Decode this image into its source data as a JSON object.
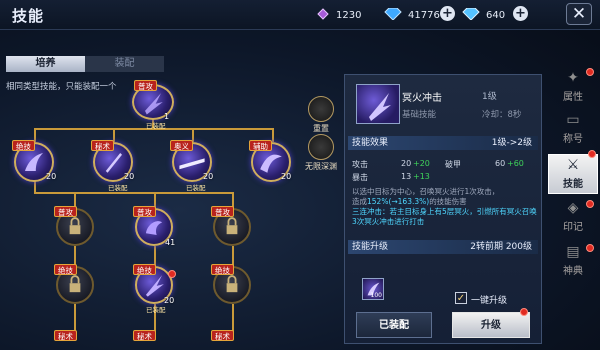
{
  "header": {
    "title": "技能"
  },
  "currencies": [
    {
      "icon": "purple-gem-icon",
      "value": "1230"
    },
    {
      "icon": "blue-diamond-icon",
      "value": "41776"
    },
    {
      "icon": "blue-diamond-icon",
      "value": "640"
    }
  ],
  "left_tabs": [
    {
      "label": "培养"
    },
    {
      "label": "装配"
    }
  ],
  "hint": "相同类型技能，只能装配一个",
  "skill_tree": {
    "root": {
      "tag": "普攻",
      "count": "1",
      "equipped": "已装配"
    },
    "row1": [
      {
        "tag": "绝技",
        "count": "20",
        "equipped": ""
      },
      {
        "tag": "秘术",
        "count": "20",
        "equipped": "已装配"
      },
      {
        "tag": "奥义",
        "count": "20",
        "equipped": "已装配"
      },
      {
        "tag": "辅助",
        "count": "20",
        "equipped": ""
      }
    ],
    "row2": [
      {
        "tag": "普攻",
        "count": "",
        "equipped": ""
      },
      {
        "tag": "普攻",
        "count": "41",
        "equipped": ""
      },
      {
        "tag": "普攻",
        "count": "",
        "equipped": ""
      }
    ],
    "row3": [
      {
        "tag": "绝技",
        "count": "",
        "equipped": ""
      },
      {
        "tag": "绝技",
        "count": "20",
        "equipped": "已装配"
      },
      {
        "tag": "绝技",
        "count": "",
        "equipped": ""
      }
    ],
    "row4": [
      {
        "tag": "秘术"
      },
      {
        "tag": "秘术"
      },
      {
        "tag": "秘术"
      }
    ]
  },
  "side_actions": [
    {
      "label": "重置"
    },
    {
      "label": "无限深渊"
    }
  ],
  "detail": {
    "name": "冥火冲击",
    "level": "1级",
    "type": "基础技能",
    "cooldown": "冷却：8秒",
    "effect_header": "技能效果",
    "level_change": "1级->2级",
    "stats": [
      {
        "label": "攻击",
        "base": "20",
        "plus": "+20"
      },
      {
        "label": "破甲",
        "base": "60",
        "plus": "+60"
      },
      {
        "label": "暴击",
        "base": "13",
        "plus": "+13"
      }
    ],
    "desc_line1": "以选中目标为中心，召唤冥火进行1次攻击，",
    "desc_line2a": "造成",
    "desc_line2b": "152%(→163.3%)",
    "desc_line2c": "的技能伤害",
    "desc_line3": "三连冲击：若主目标身上有5层冥火，引燃所有冥火召唤3次冥火冲击进行打击",
    "upgrade_header": "技能升级",
    "upgrade_req": "2转前期 200级",
    "item_count": "100",
    "auto_label": "一键升级",
    "equipped_button": "已装配",
    "upgrade_button": "升级"
  },
  "right_tabs": [
    {
      "label": "属性",
      "icon": "attribute-icon"
    },
    {
      "label": "称号",
      "icon": "title-icon"
    },
    {
      "label": "技能",
      "icon": "skill-icon"
    },
    {
      "label": "印记",
      "icon": "mark-icon"
    },
    {
      "label": "神典",
      "icon": "codex-icon"
    }
  ]
}
